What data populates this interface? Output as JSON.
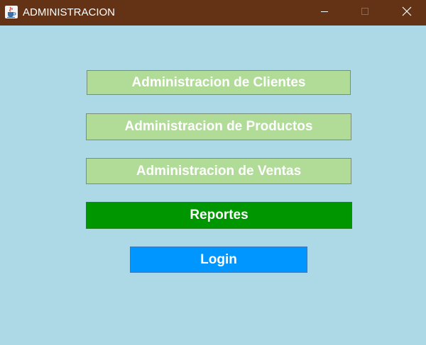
{
  "window": {
    "title": "ADMINISTRACION",
    "app_icon": "java-cup-icon",
    "controls": [
      "minimize-icon",
      "maximize-icon",
      "close-icon"
    ]
  },
  "colors": {
    "titlebar": "#643215",
    "background": "#ADD8E6",
    "light_button": "#B0DC98",
    "reportes_button": "#009600",
    "login_button": "#0096FF",
    "button_text": "#FFFFFF"
  },
  "menu": {
    "clientes_label": "Administracion de Clientes",
    "productos_label": "Administracion de Productos",
    "ventas_label": "Administracion de Ventas",
    "reportes_label": "Reportes",
    "login_label": "Login"
  }
}
